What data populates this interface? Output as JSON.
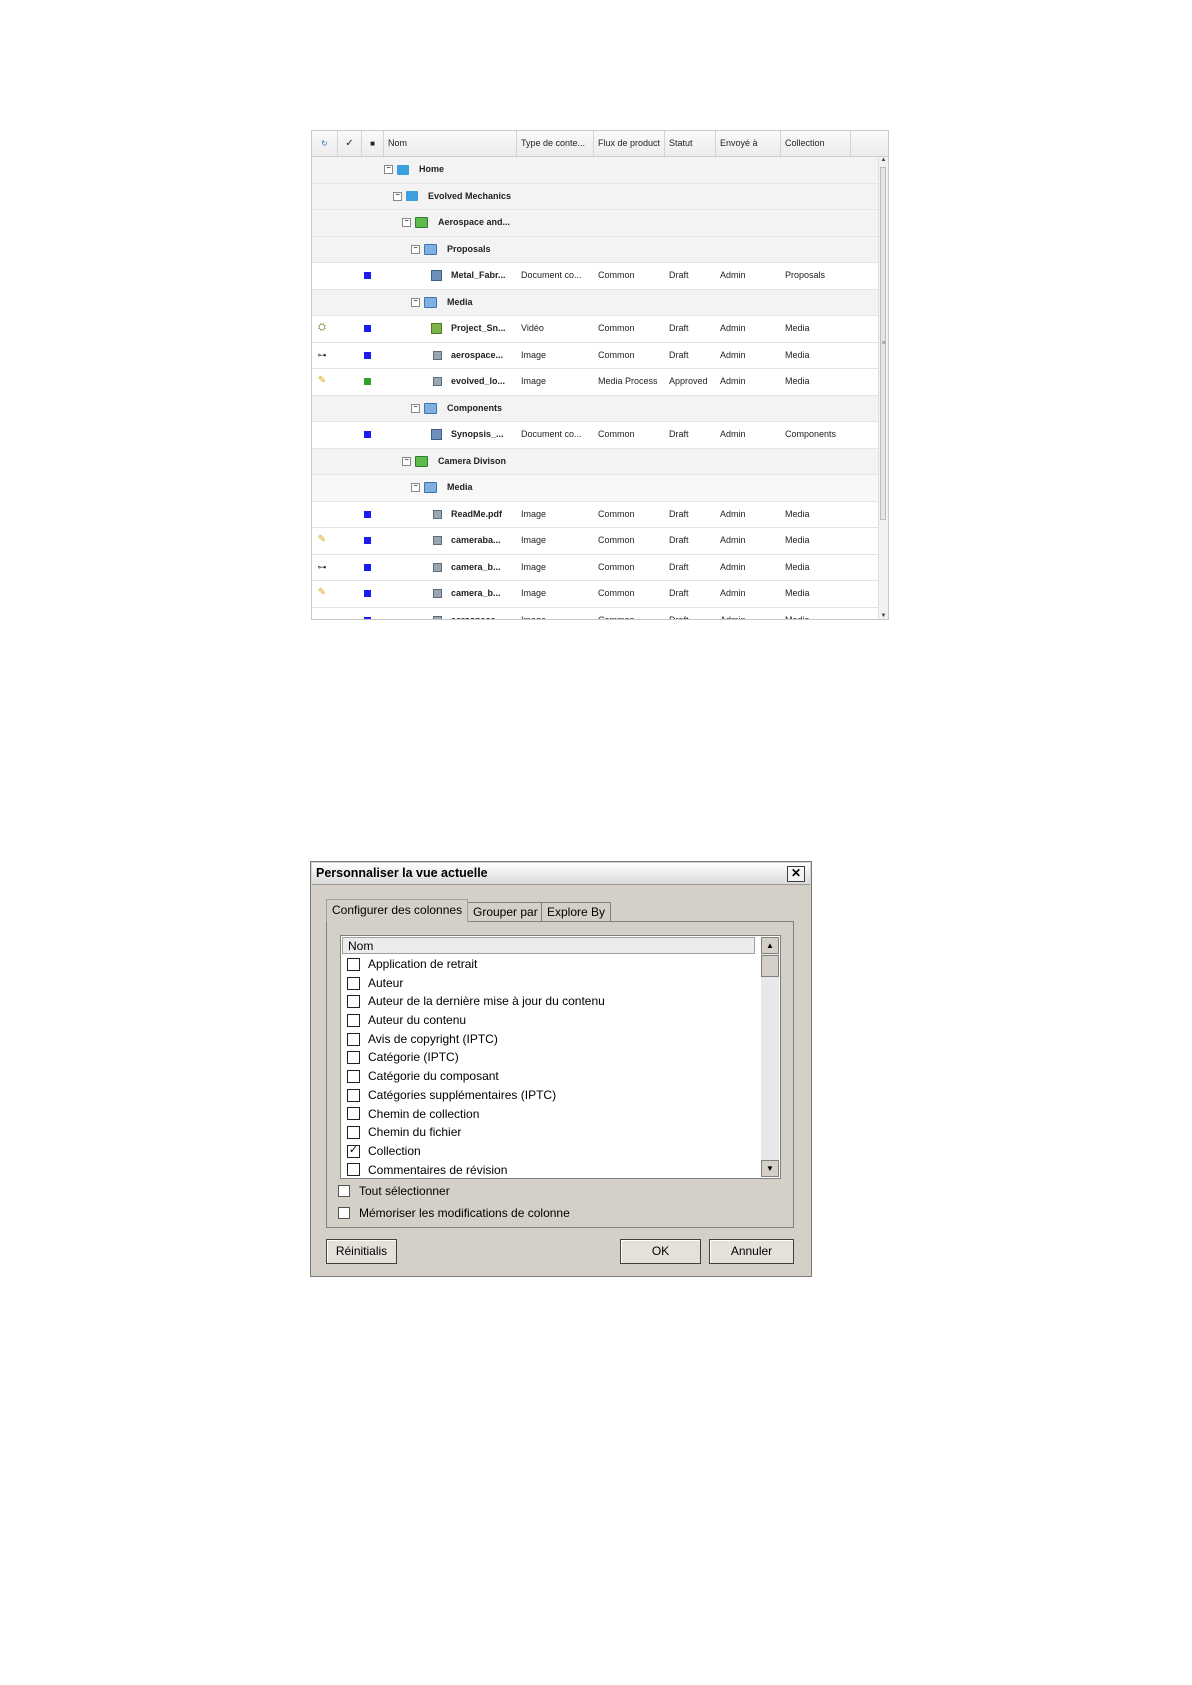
{
  "grid": {
    "headers": [
      "",
      "",
      "",
      "Nom",
      "Type de conte...",
      "Flux de product",
      "Statut",
      "Envoyé à",
      "Collection"
    ],
    "rows": [
      {
        "name": "Home",
        "type": "",
        "flux": "",
        "statut": "",
        "envoye": "",
        "collection": ""
      },
      {
        "name": "Evolved Mechanics",
        "type": "",
        "flux": "",
        "statut": "",
        "envoye": "",
        "collection": ""
      },
      {
        "name": "Aerospace and...",
        "type": "",
        "flux": "",
        "statut": "",
        "envoye": "",
        "collection": ""
      },
      {
        "name": "Proposals",
        "type": "",
        "flux": "",
        "statut": "",
        "envoye": "",
        "collection": ""
      },
      {
        "name": "Metal_Fabr...",
        "type": "Document co...",
        "flux": "Common",
        "statut": "Draft",
        "envoye": "Admin",
        "collection": "Proposals"
      },
      {
        "name": "Media",
        "type": "",
        "flux": "",
        "statut": "",
        "envoye": "",
        "collection": ""
      },
      {
        "name": "Project_Sn...",
        "type": "Vidéo",
        "flux": "Common",
        "statut": "Draft",
        "envoye": "Admin",
        "collection": "Media"
      },
      {
        "name": "aerospace...",
        "type": "Image",
        "flux": "Common",
        "statut": "Draft",
        "envoye": "Admin",
        "collection": "Media"
      },
      {
        "name": "evolved_lo...",
        "type": "Image",
        "flux": "Media Process",
        "statut": "Approved",
        "envoye": "Admin",
        "collection": "Media"
      },
      {
        "name": "Components",
        "type": "",
        "flux": "",
        "statut": "",
        "envoye": "",
        "collection": ""
      },
      {
        "name": "Synopsis_...",
        "type": "Document co...",
        "flux": "Common",
        "statut": "Draft",
        "envoye": "Admin",
        "collection": "Components"
      },
      {
        "name": "Camera Divison",
        "type": "",
        "flux": "",
        "statut": "",
        "envoye": "",
        "collection": ""
      },
      {
        "name": "Media",
        "type": "",
        "flux": "",
        "statut": "",
        "envoye": "",
        "collection": ""
      },
      {
        "name": "ReadMe.pdf",
        "type": "Image",
        "flux": "Common",
        "statut": "Draft",
        "envoye": "Admin",
        "collection": "Media"
      },
      {
        "name": "cameraba...",
        "type": "Image",
        "flux": "Common",
        "statut": "Draft",
        "envoye": "Admin",
        "collection": "Media"
      },
      {
        "name": "camera_b...",
        "type": "Image",
        "flux": "Common",
        "statut": "Draft",
        "envoye": "Admin",
        "collection": "Media"
      },
      {
        "name": "camera_b...",
        "type": "Image",
        "flux": "Common",
        "statut": "Draft",
        "envoye": "Admin",
        "collection": "Media"
      },
      {
        "name": "aerospace...",
        "type": "Image",
        "flux": "Common",
        "statut": "Draft",
        "envoye": "Admin",
        "collection": "Media"
      }
    ]
  },
  "dialog": {
    "title": "Personnaliser la vue actuelle",
    "close": "✕",
    "tabs": [
      "Configurer des colonnes",
      "Grouper par",
      "Explore By"
    ],
    "list_header": "Nom",
    "items": [
      {
        "label": "Application de retrait",
        "checked": false
      },
      {
        "label": "Auteur",
        "checked": false
      },
      {
        "label": "Auteur de la dernière mise à jour du contenu",
        "checked": false
      },
      {
        "label": "Auteur du contenu",
        "checked": false
      },
      {
        "label": "Avis de copyright (IPTC)",
        "checked": false
      },
      {
        "label": "Catégorie (IPTC)",
        "checked": false
      },
      {
        "label": "Catégorie du composant",
        "checked": false
      },
      {
        "label": "Catégories supplémentaires (IPTC)",
        "checked": false
      },
      {
        "label": "Chemin de collection",
        "checked": false
      },
      {
        "label": "Chemin du fichier",
        "checked": false
      },
      {
        "label": "Collection",
        "checked": true
      },
      {
        "label": "Commentaires de révision",
        "checked": false
      }
    ],
    "select_all": "Tout sélectionner",
    "remember": "Mémoriser les modifications de colonne",
    "reset": "Réinitialis",
    "ok": "OK",
    "cancel": "Annuler"
  }
}
